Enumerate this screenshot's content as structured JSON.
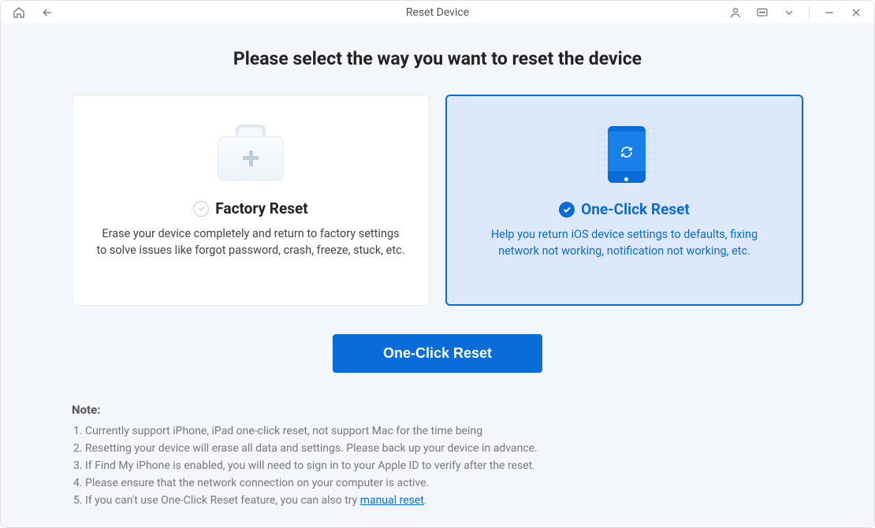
{
  "titlebar": {
    "title": "Reset Device"
  },
  "heading": "Please select the way you want to reset the device",
  "cards": {
    "factory": {
      "title": "Factory Reset",
      "desc": "Erase your device completely and return to factory settings to solve issues like forgot password, crash, freeze, stuck, etc."
    },
    "oneclick": {
      "title": "One-Click Reset",
      "desc": "Help you return iOS device settings to defaults, fixing network not working, notification not working, etc."
    }
  },
  "action_button": "One-Click Reset",
  "notes": {
    "title": "Note:",
    "items": [
      "Currently support iPhone, iPad one-click reset, not support Mac for the time being",
      "Resetting your device will erase all data and settings. Please back up your device in advance.",
      "If Find My iPhone is enabled, you will need to sign in to your Apple ID to verify after the reset.",
      "Please ensure that the network connection on your computer is active."
    ],
    "item5_prefix": "If you can't use One-Click Reset feature, you can also try ",
    "item5_link": "manual reset",
    "item5_suffix": "."
  }
}
